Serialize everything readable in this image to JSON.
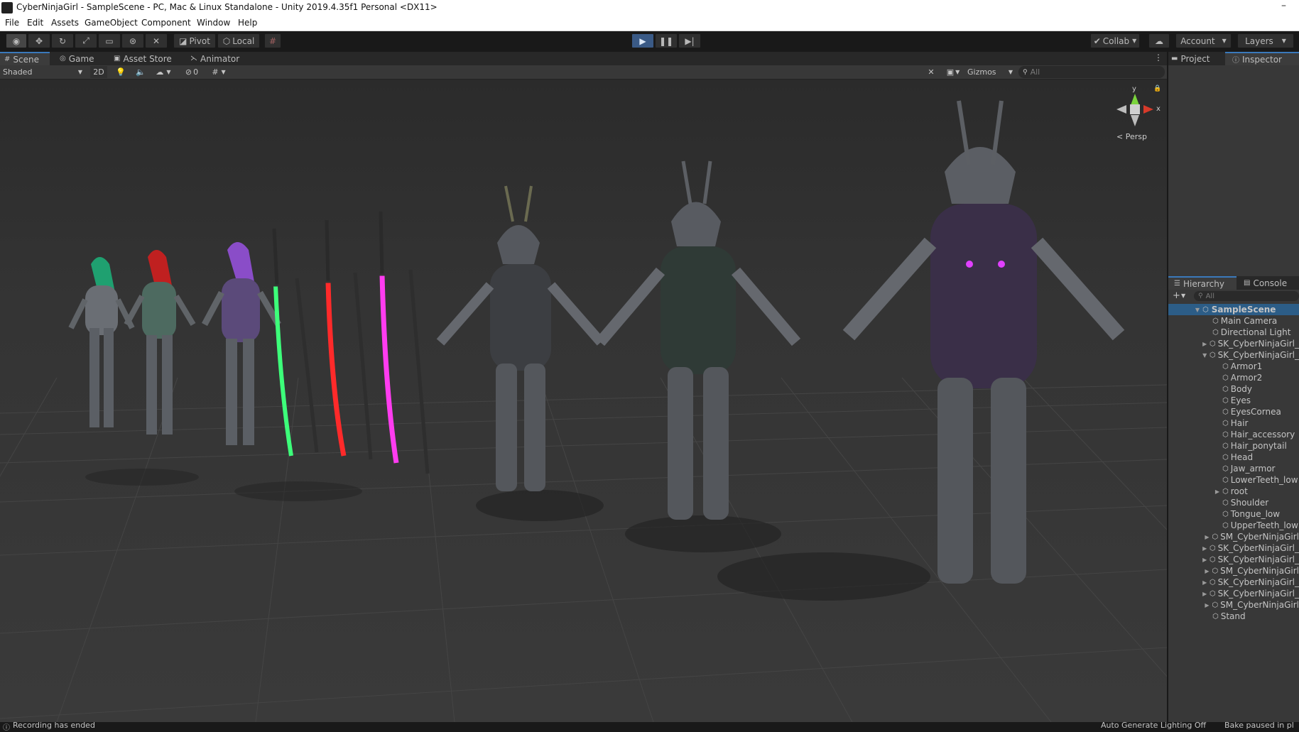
{
  "window": {
    "title": "CyberNinjaGirl - SampleScene - PC, Mac & Linux Standalone - Unity 2019.4.35f1 Personal <DX11>",
    "minimize_glyph": "–"
  },
  "menu": [
    "File",
    "Edit",
    "Assets",
    "GameObject",
    "Component",
    "Window",
    "Help"
  ],
  "toolbar": {
    "pivot_label": "Pivot",
    "local_label": "Local",
    "collab_label": "Collab",
    "account_label": "Account",
    "layers_label": "Layers"
  },
  "scene_tabs": [
    "Scene",
    "Game",
    "Asset Store",
    "Animator"
  ],
  "scene_bar": {
    "shading_mode": "Shaded",
    "mode_2d": "2D",
    "hidden_count": "0",
    "gizmos_label": "Gizmos",
    "search_placeholder": "All"
  },
  "gizmo": {
    "y_label": "y",
    "x_label": "x",
    "persp_label": "< Persp"
  },
  "right_tabs_top": [
    "Project",
    "Inspector"
  ],
  "right_tabs_bottom": [
    "Hierarchy",
    "Console"
  ],
  "hierarchy": {
    "search_placeholder": "All",
    "scene_name": "SampleScene",
    "items": [
      {
        "label": "Main Camera",
        "depth": 1,
        "arrow": ""
      },
      {
        "label": "Directional Light",
        "depth": 1,
        "arrow": ""
      },
      {
        "label": "SK_CyberNinjaGirl_",
        "depth": 1,
        "arrow": "▶"
      },
      {
        "label": "SK_CyberNinjaGirl_",
        "depth": 1,
        "arrow": "▼"
      },
      {
        "label": "Armor1",
        "depth": 2,
        "arrow": ""
      },
      {
        "label": "Armor2",
        "depth": 2,
        "arrow": ""
      },
      {
        "label": "Body",
        "depth": 2,
        "arrow": ""
      },
      {
        "label": "Eyes",
        "depth": 2,
        "arrow": ""
      },
      {
        "label": "EyesCornea",
        "depth": 2,
        "arrow": ""
      },
      {
        "label": "Hair",
        "depth": 2,
        "arrow": ""
      },
      {
        "label": "Hair_accessory",
        "depth": 2,
        "arrow": ""
      },
      {
        "label": "Hair_ponytail",
        "depth": 2,
        "arrow": ""
      },
      {
        "label": "Head",
        "depth": 2,
        "arrow": ""
      },
      {
        "label": "Jaw_armor",
        "depth": 2,
        "arrow": ""
      },
      {
        "label": "LowerTeeth_low",
        "depth": 2,
        "arrow": ""
      },
      {
        "label": "root",
        "depth": 2,
        "arrow": "▶"
      },
      {
        "label": "Shoulder",
        "depth": 2,
        "arrow": ""
      },
      {
        "label": "Tongue_low",
        "depth": 2,
        "arrow": ""
      },
      {
        "label": "UpperTeeth_low",
        "depth": 2,
        "arrow": ""
      },
      {
        "label": "SM_CyberNinjaGirl",
        "depth": 1,
        "arrow": "▶"
      },
      {
        "label": "SK_CyberNinjaGirl_",
        "depth": 1,
        "arrow": "▶"
      },
      {
        "label": "SK_CyberNinjaGirl_",
        "depth": 1,
        "arrow": "▶"
      },
      {
        "label": "SM_CyberNinjaGirl",
        "depth": 1,
        "arrow": "▶"
      },
      {
        "label": "SK_CyberNinjaGirl_",
        "depth": 1,
        "arrow": "▶"
      },
      {
        "label": "SK_CyberNinjaGirl_",
        "depth": 1,
        "arrow": "▶"
      },
      {
        "label": "SM_CyberNinjaGirl",
        "depth": 1,
        "arrow": "▶"
      },
      {
        "label": "Stand",
        "depth": 1,
        "arrow": ""
      }
    ]
  },
  "status": {
    "left": "Recording has ended",
    "right1": "Auto Generate Lighting Off",
    "right2": "Bake paused in pl"
  },
  "colors": {
    "play_accent": "#3a5a86",
    "tab_accent": "#3a79bb",
    "sword_green": "#3dff7a",
    "sword_red": "#ff2a2a",
    "sword_pink": "#ff3cf0"
  }
}
